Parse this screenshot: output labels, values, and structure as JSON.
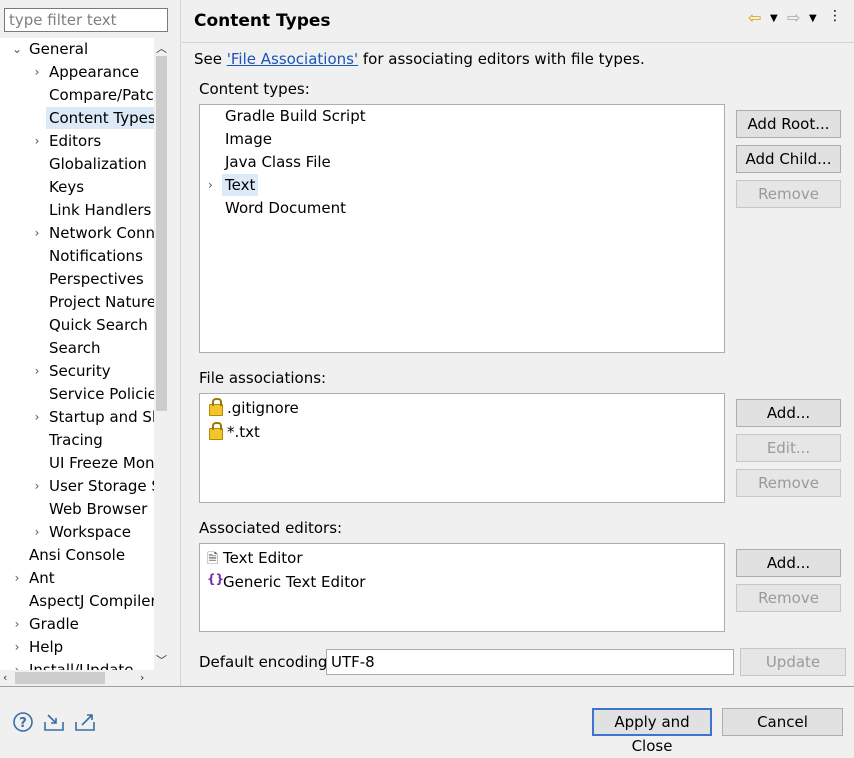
{
  "filter": {
    "placeholder": "type filter text"
  },
  "tree": [
    {
      "label": "General",
      "level": 0,
      "arrow": "down",
      "selected": false
    },
    {
      "label": "Appearance",
      "level": 1,
      "arrow": "right",
      "selected": false
    },
    {
      "label": "Compare/Patch",
      "level": 1,
      "arrow": "none",
      "selected": false
    },
    {
      "label": "Content Types",
      "level": 1,
      "arrow": "none",
      "selected": true
    },
    {
      "label": "Editors",
      "level": 1,
      "arrow": "right",
      "selected": false
    },
    {
      "label": "Globalization",
      "level": 1,
      "arrow": "none",
      "selected": false
    },
    {
      "label": "Keys",
      "level": 1,
      "arrow": "none",
      "selected": false
    },
    {
      "label": "Link Handlers",
      "level": 1,
      "arrow": "none",
      "selected": false
    },
    {
      "label": "Network Conne",
      "level": 1,
      "arrow": "right",
      "selected": false
    },
    {
      "label": "Notifications",
      "level": 1,
      "arrow": "none",
      "selected": false
    },
    {
      "label": "Perspectives",
      "level": 1,
      "arrow": "none",
      "selected": false
    },
    {
      "label": "Project Natures",
      "level": 1,
      "arrow": "none",
      "selected": false
    },
    {
      "label": "Quick Search",
      "level": 1,
      "arrow": "none",
      "selected": false
    },
    {
      "label": "Search",
      "level": 1,
      "arrow": "none",
      "selected": false
    },
    {
      "label": "Security",
      "level": 1,
      "arrow": "right",
      "selected": false
    },
    {
      "label": "Service Policies",
      "level": 1,
      "arrow": "none",
      "selected": false
    },
    {
      "label": "Startup and Shu",
      "level": 1,
      "arrow": "right",
      "selected": false
    },
    {
      "label": "Tracing",
      "level": 1,
      "arrow": "none",
      "selected": false
    },
    {
      "label": "UI Freeze Moni",
      "level": 1,
      "arrow": "none",
      "selected": false
    },
    {
      "label": "User Storage Se",
      "level": 1,
      "arrow": "right",
      "selected": false
    },
    {
      "label": "Web Browser",
      "level": 1,
      "arrow": "none",
      "selected": false
    },
    {
      "label": "Workspace",
      "level": 1,
      "arrow": "right",
      "selected": false
    },
    {
      "label": "Ansi Console",
      "level": 0,
      "arrow": "none",
      "selected": false
    },
    {
      "label": "Ant",
      "level": 0,
      "arrow": "right",
      "selected": false
    },
    {
      "label": "AspectJ Compiler",
      "level": 0,
      "arrow": "none",
      "selected": false
    },
    {
      "label": "Gradle",
      "level": 0,
      "arrow": "right",
      "selected": false
    },
    {
      "label": "Help",
      "level": 0,
      "arrow": "right",
      "selected": false
    },
    {
      "label": "Install/Update",
      "level": 0,
      "arrow": "right",
      "selected": false
    }
  ],
  "page": {
    "title": "Content Types",
    "desc_prefix": "See ",
    "desc_link": "'File Associations'",
    "desc_suffix": " for associating editors with file types."
  },
  "content_types": {
    "label": "Content types:",
    "items": [
      "Gradle Build Script",
      "Image",
      "Java Class File",
      "Text",
      "Word Document"
    ],
    "add_root": "Add Root...",
    "add_child": "Add Child...",
    "remove": "Remove"
  },
  "file_associations": {
    "label": "File associations:",
    "items": [
      ".gitignore",
      "*.txt"
    ],
    "add": "Add...",
    "edit": "Edit...",
    "remove": "Remove"
  },
  "associated_editors": {
    "label": "Associated editors:",
    "items": [
      "Text Editor",
      "Generic Text Editor"
    ],
    "add": "Add...",
    "remove": "Remove"
  },
  "encoding": {
    "label": "Default encoding:",
    "value": "UTF-8",
    "update": "Update"
  },
  "footer": {
    "apply_close": "Apply and Close",
    "cancel": "Cancel"
  }
}
